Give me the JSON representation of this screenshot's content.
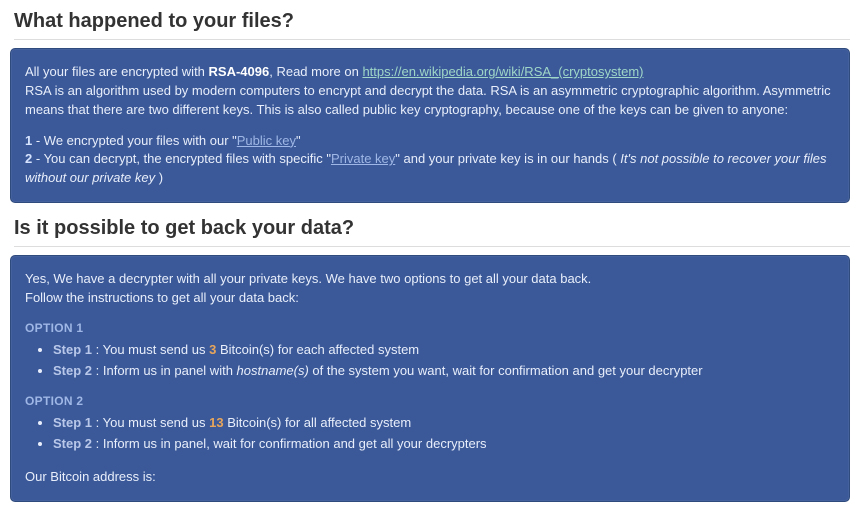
{
  "section1": {
    "title": "What happened to your files?",
    "intro_prefix": "All your files are encrypted with ",
    "rsa_bold": "RSA-4096",
    "intro_mid": ", Read more on ",
    "wiki_url_text": "https://en.wikipedia.org/wiki/RSA_(cryptosystem)",
    "desc": "RSA is an algorithm used by modern computers to encrypt and decrypt the data. RSA is an asymmetric cryptographic algorithm. Asymmetric means that there are two different keys. This is also called public key cryptography, because one of the keys can be given to anyone:",
    "pt1_num": "1",
    "pt1_dash": " - ",
    "pt1_text_a": "We encrypted your files with our \"",
    "pt1_key": "Public key",
    "pt1_text_b": "\"",
    "pt2_num": "2",
    "pt2_dash": " - ",
    "pt2_text_a": "You can decrypt, the encrypted files with specific \"",
    "pt2_key": "Private key",
    "pt2_text_b": "\" and your private key is in our hands ( ",
    "pt2_ital": "It's not possible to recover your files without our private key",
    "pt2_text_c": " )"
  },
  "section2": {
    "title": "Is it possible to get back your data?",
    "yes_line": "Yes, We have a decrypter with all your private keys. We have two options to get all your data back.",
    "follow_line": "Follow the instructions to get all your data back:",
    "option1": {
      "label": "OPTION 1",
      "step1_label": "Step 1",
      "step1_sep": " : ",
      "step1_a": "You must send us ",
      "step1_btc": "3",
      "step1_b": " Bitcoin(s) for each affected system",
      "step2_label": "Step 2",
      "step2_sep": " : ",
      "step2_a": "Inform us in panel with ",
      "step2_hostnames": "hostname(s)",
      "step2_b": " of the system you want, wait for confirmation and get your decrypter"
    },
    "option2": {
      "label": "OPTION 2",
      "step1_label": "Step 1",
      "step1_sep": " : ",
      "step1_a": "You must send us ",
      "step1_btc": "13",
      "step1_b": " Bitcoin(s) for all affected system",
      "step2_label": "Step 2",
      "step2_sep": " : ",
      "step2_text": "Inform us in panel, wait for confirmation and get all your decrypters"
    },
    "addr_label": "Our Bitcoin address is:"
  }
}
